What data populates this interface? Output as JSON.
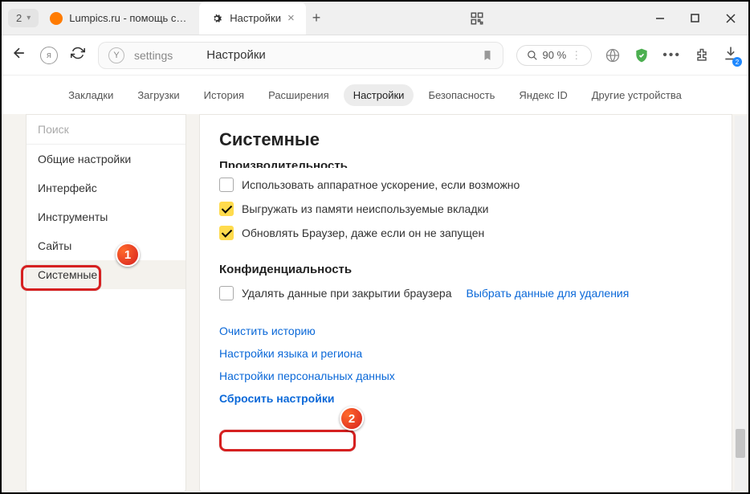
{
  "titlebar": {
    "group_count": "2",
    "tab1_title": "Lumpics.ru - помощь с ко",
    "tab2_title": "Настройки"
  },
  "address": {
    "url_text": "settings",
    "page_title": "Настройки",
    "zoom": "90 %"
  },
  "page_tabs": [
    "Закладки",
    "Загрузки",
    "История",
    "Расширения",
    "Настройки",
    "Безопасность",
    "Яндекс ID",
    "Другие устройства"
  ],
  "sidebar": {
    "search_placeholder": "Поиск",
    "items": [
      "Общие настройки",
      "Интерфейс",
      "Инструменты",
      "Сайты",
      "Системные"
    ]
  },
  "main": {
    "heading": "Системные",
    "perf_cut": "Производительность",
    "opt1": "Использовать аппаратное ускорение, если возможно",
    "opt2": "Выгружать из памяти неиспользуемые вкладки",
    "opt3": "Обновлять Браузер, даже если он не запущен",
    "privacy_head": "Конфиденциальность",
    "opt4": "Удалять данные при закрытии браузера",
    "opt4_link": "Выбрать данные для удаления",
    "links": [
      "Очистить историю",
      "Настройки языка и региона",
      "Настройки персональных данных",
      "Сбросить настройки"
    ]
  },
  "callouts": {
    "n1": "1",
    "n2": "2"
  },
  "dl_badge": "2"
}
